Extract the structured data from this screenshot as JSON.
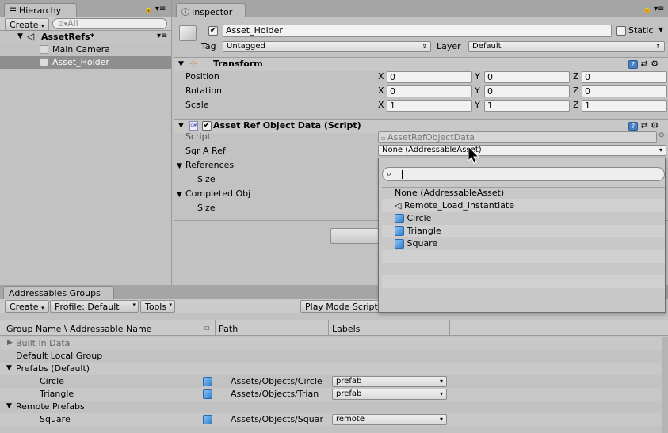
{
  "hierarchy": {
    "tab_label": "Hierarchy",
    "create_label": "Create",
    "search_placeholder": "All",
    "scene_name": "AssetRefs*",
    "items": [
      {
        "label": "Main Camera"
      },
      {
        "label": "Asset_Holder"
      }
    ]
  },
  "inspector": {
    "tab_label": "Inspector",
    "object_name": "Asset_Holder",
    "static_label": "Static",
    "tag_label": "Tag",
    "tag_value": "Untagged",
    "layer_label": "Layer",
    "layer_value": "Default",
    "transform": {
      "title": "Transform",
      "rows": [
        {
          "label": "Position",
          "x": "0",
          "y": "0",
          "z": "0"
        },
        {
          "label": "Rotation",
          "x": "0",
          "y": "0",
          "z": "0"
        },
        {
          "label": "Scale",
          "x": "1",
          "y": "1",
          "z": "1"
        }
      ],
      "axis_x": "X",
      "axis_y": "Y",
      "axis_z": "Z"
    },
    "script_component": {
      "title": "Asset Ref Object Data (Script)",
      "script_label": "Script",
      "script_value": "AssetRefObjectData",
      "sqr_label": "Sqr A Ref",
      "sqr_value": "None (AddressableAsset)",
      "references_label": "References",
      "size_label": "Size",
      "completed_label": "Completed Obj",
      "size2_label": "Size"
    }
  },
  "popup": {
    "search_value": "",
    "items": [
      {
        "label": "None (AddressableAsset)",
        "icon": "none"
      },
      {
        "label": "Remote_Load_Instantiate",
        "icon": "unity-scene-icon"
      },
      {
        "label": "Circle",
        "icon": "prefab-cube-icon"
      },
      {
        "label": "Triangle",
        "icon": "prefab-cube-icon"
      },
      {
        "label": "Square",
        "icon": "prefab-cube-icon"
      }
    ]
  },
  "addressables": {
    "tab_label": "Addressables Groups",
    "create_label": "Create",
    "profile_label": "Profile: Default",
    "tools_label": "Tools",
    "playmode_label": "Play Mode Script",
    "columns": {
      "name": "Group Name \\ Addressable Name",
      "path": "Path",
      "labels": "Labels"
    },
    "rows": [
      {
        "kind": "group",
        "name": "Built In Data",
        "collapsed": true,
        "muted": true
      },
      {
        "kind": "group",
        "name": "Default Local Group"
      },
      {
        "kind": "group",
        "name": "Prefabs (Default)",
        "expanded": true
      },
      {
        "kind": "entry",
        "name": "Circle",
        "path": "Assets/Objects/Circle",
        "label": "prefab"
      },
      {
        "kind": "entry",
        "name": "Triangle",
        "path": "Assets/Objects/Trian",
        "label": "prefab"
      },
      {
        "kind": "group",
        "name": "Remote Prefabs",
        "expanded": true
      },
      {
        "kind": "entry",
        "name": "Square",
        "path": "Assets/Objects/Squar",
        "label": "remote"
      }
    ]
  },
  "colors": {
    "selection": "#8e8e8e",
    "editor_bg": "#c2c2c2",
    "header_bg": "#a5a5a5",
    "prefab_blue": "#2f7fd0"
  }
}
